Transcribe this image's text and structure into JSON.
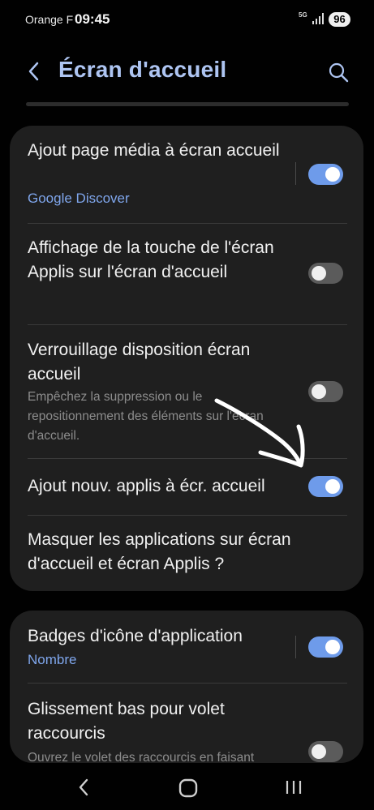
{
  "status_bar": {
    "carrier": "Orange F",
    "time": "09:45",
    "network": "5G",
    "battery": "96"
  },
  "header": {
    "title": "Écran d'accueil",
    "back_icon": "back-arrow-icon",
    "search_icon": "search-icon"
  },
  "settings_group_1": [
    {
      "title": "Ajout page média à écran accueil",
      "subtitle": "Google Discover",
      "toggle": "on"
    },
    {
      "title": "Affichage de la touche de l'écran Applis sur l'écran d'accueil",
      "toggle": "off"
    },
    {
      "title": "Verrouillage disposition écran accueil",
      "description": "Empêchez la suppression ou le repositionnement des éléments sur l'écran d'accueil.",
      "toggle": "off"
    },
    {
      "title": "Ajout nouv. applis à écr. accueil",
      "toggle": "on"
    },
    {
      "title": "Masquer les applications sur écran d'accueil et écran Applis ?"
    }
  ],
  "settings_group_2": [
    {
      "title": "Badges d'icône d'application",
      "subtitle": "Nombre",
      "toggle": "on"
    },
    {
      "title": "Glissement bas pour volet raccourcis",
      "description": "Ouvrez le volet des raccourcis en faisant",
      "toggle": "off"
    }
  ],
  "annotation": {
    "icon": "hand-drawn-arrow-icon",
    "color": "#ffffff"
  },
  "colors": {
    "accent": "#aec5f2",
    "toggle_on": "#6e9bea",
    "subtitle": "#7fa6ec",
    "card": "#1f1f1f",
    "background": "#010101"
  },
  "nav_bar": {
    "back_icon": "nav-back-icon",
    "home_icon": "nav-home-icon",
    "recents_icon": "nav-recents-icon"
  }
}
